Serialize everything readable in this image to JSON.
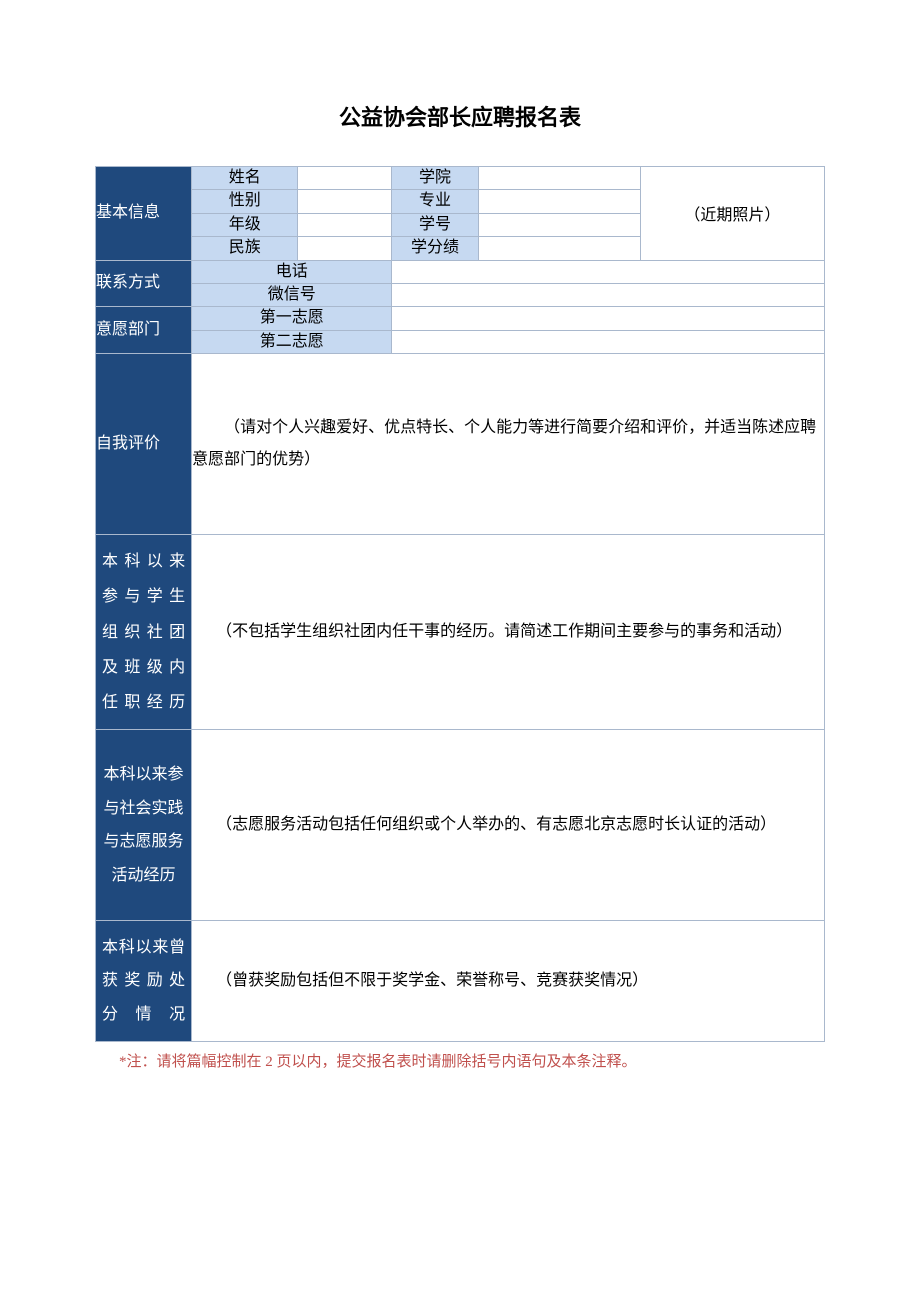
{
  "title": "公益协会部长应聘报名表",
  "sections": {
    "basic": {
      "head": "基本信息",
      "fields": {
        "name": {
          "label": "姓名",
          "value": ""
        },
        "college": {
          "label": "学院",
          "value": ""
        },
        "gender": {
          "label": "性别",
          "value": ""
        },
        "major": {
          "label": "专业",
          "value": ""
        },
        "grade": {
          "label": "年级",
          "value": ""
        },
        "stuno": {
          "label": "学号",
          "value": ""
        },
        "ethnic": {
          "label": "民族",
          "value": ""
        },
        "gpa": {
          "label": "学分绩",
          "value": ""
        }
      },
      "photo": "（近期照片）"
    },
    "contact": {
      "head": "联系方式",
      "phone": {
        "label": "电话",
        "value": ""
      },
      "wechat": {
        "label": "微信号",
        "value": ""
      }
    },
    "wish": {
      "head": "意愿部门",
      "first": {
        "label": "第一志愿",
        "value": ""
      },
      "second": {
        "label": "第二志愿",
        "value": ""
      }
    },
    "selfeval": {
      "head": "自我评价",
      "hint": "（请对个人兴趣爱好、优点特长、个人能力等进行简要介绍和评价，并适当陈述应聘意愿部门的优势）"
    },
    "experience": {
      "head": "本 科 以 来 参 与 学 生 组 织 社 团 及 班 级 内 任职经历",
      "hint": "（不包括学生组织社团内任干事的经历。请简述工作期间主要参与的事务和活动）"
    },
    "volunteer": {
      "head": "本科以来参与社会实践与志愿服务活动经历",
      "hint": "（志愿服务活动包括任何组织或个人举办的、有志愿北京志愿时长认证的活动）"
    },
    "awards": {
      "head": "本科以来曾 获 奖 励 处分情况",
      "hint": "（曾获奖励包括但不限于奖学金、荣誉称号、竞赛获奖情况）"
    }
  },
  "note": "*注：请将篇幅控制在 2 页以内，提交报名表时请删除括号内语句及本条注释。"
}
